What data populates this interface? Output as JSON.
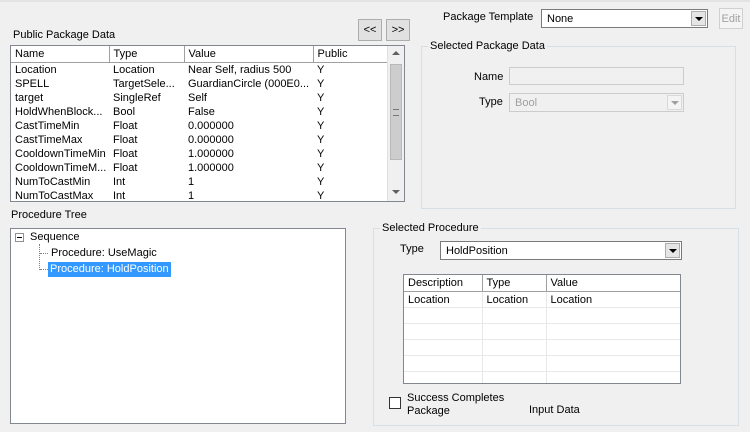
{
  "public_package": {
    "title": "Public Package Data",
    "nav_prev": "<<",
    "nav_next": ">>",
    "columns": [
      "Name",
      "Type",
      "Value",
      "Public"
    ],
    "rows": [
      [
        "Location",
        "Location",
        "Near Self, radius 500",
        "Y"
      ],
      [
        "SPELL",
        "TargetSele...",
        "GuardianCircle (000E0...",
        "Y"
      ],
      [
        "target",
        "SingleRef",
        "Self",
        "Y"
      ],
      [
        "HoldWhenBlock...",
        "Bool",
        "False",
        "Y"
      ],
      [
        "CastTimeMin",
        "Float",
        "0.000000",
        "Y"
      ],
      [
        "CastTimeMax",
        "Float",
        "0.000000",
        "Y"
      ],
      [
        "CooldownTimeMin",
        "Float",
        "1.000000",
        "Y"
      ],
      [
        "CooldownTimeM...",
        "Float",
        "1.000000",
        "Y"
      ],
      [
        "NumToCastMin",
        "Int",
        "1",
        "Y"
      ],
      [
        "NumToCastMax",
        "Int",
        "1",
        "Y"
      ]
    ]
  },
  "package_template": {
    "label": "Package Template",
    "value": "None",
    "edit_label": "Edit"
  },
  "selected_package": {
    "title": "Selected Package Data",
    "name_label": "Name",
    "name_value": "",
    "type_label": "Type",
    "type_value": "Bool"
  },
  "procedure_tree": {
    "title": "Procedure Tree",
    "expander": "−",
    "root": "Sequence",
    "children": [
      "Procedure: UseMagic",
      "Procedure: HoldPosition"
    ]
  },
  "selected_procedure": {
    "title": "Selected Procedure",
    "type_label": "Type",
    "type_value": "HoldPosition",
    "columns": [
      "Description",
      "Type",
      "Value"
    ],
    "rows": [
      [
        "Location",
        "Location",
        "Location"
      ]
    ],
    "success_label": "Success Completes Package",
    "input_data_label": "Input Data"
  },
  "colors": {
    "selection": "#3399ff",
    "window_bg": "#f0f0f0"
  }
}
